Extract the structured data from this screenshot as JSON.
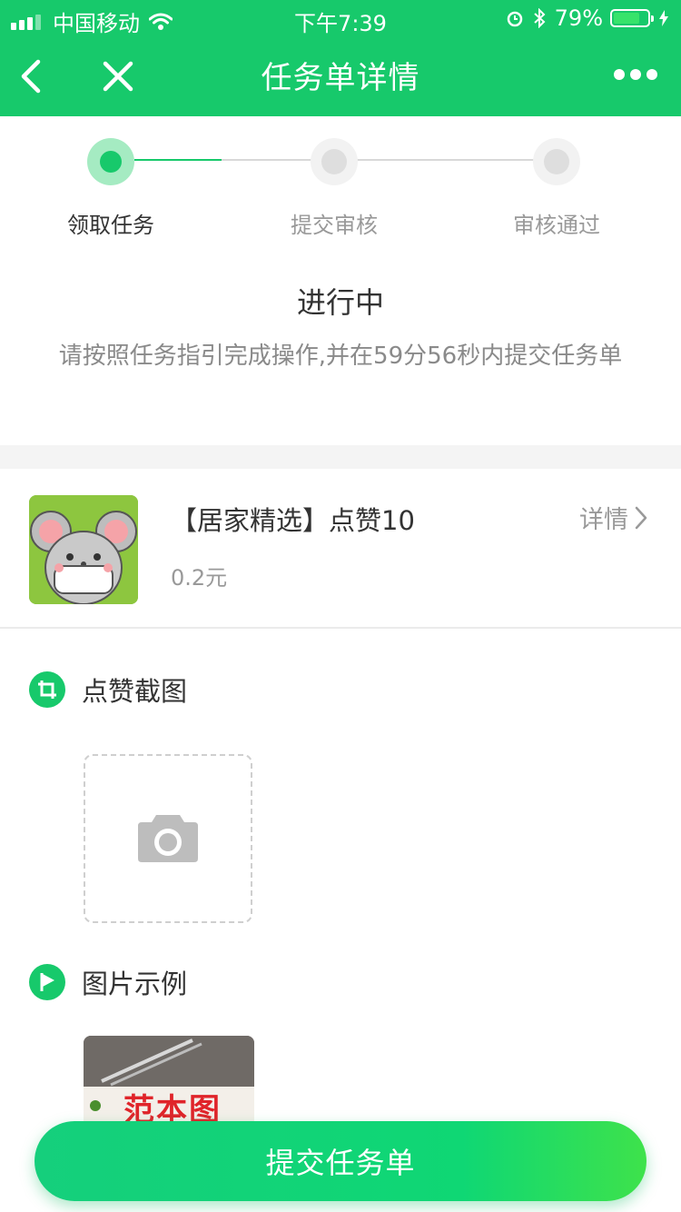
{
  "status_bar": {
    "carrier": "中国移动",
    "time": "下午7:39",
    "battery": "79%",
    "battery_level": 0.79
  },
  "navbar": {
    "title": "任务单详情",
    "back_icon": "chevron-left-icon",
    "close_icon": "close-icon",
    "more_icon": "more-icon"
  },
  "steps": [
    {
      "label": "领取任务",
      "state": "active"
    },
    {
      "label": "提交审核",
      "state": "pending"
    },
    {
      "label": "审核通过",
      "state": "pending"
    }
  ],
  "progress": {
    "title": "进行中",
    "description": "请按照任务指引完成操作,并在59分56秒内提交任务单"
  },
  "task": {
    "title": "【居家精选】点赞10",
    "price": "0.2元",
    "detail_label": "详情"
  },
  "screenshot_section": {
    "label": "点赞截图",
    "icon": "crop-icon",
    "upload_icon": "camera-icon"
  },
  "example_section": {
    "label": "图片示例",
    "icon": "flag-icon",
    "sample_text": "范本图"
  },
  "submit_label": "提交任务单",
  "colors": {
    "primary": "#17c96b",
    "step_inactive": "#e0e0e0",
    "muted_text": "#999999"
  }
}
